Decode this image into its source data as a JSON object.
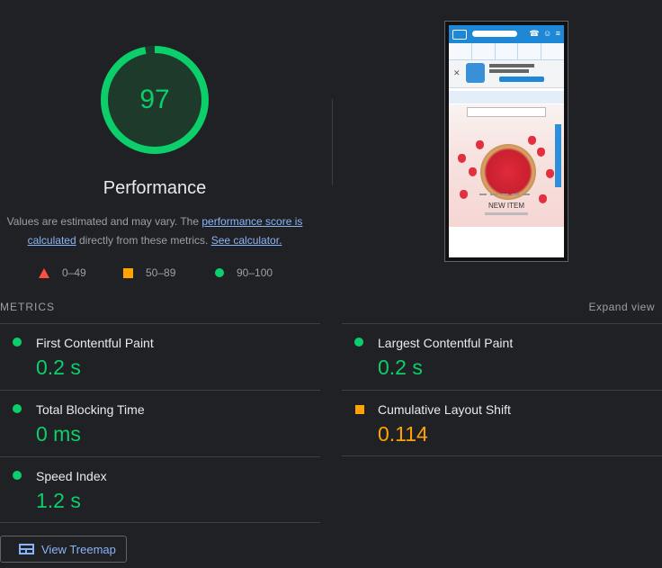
{
  "gauge": {
    "score": "97",
    "title": "Performance",
    "fraction": 0.97,
    "color": "#0cce6b"
  },
  "note": {
    "prefix": "Values are estimated and may vary. The ",
    "link1": "performance score is calculated",
    "middle": " directly from these metrics. ",
    "link2": "See calculator."
  },
  "legend": [
    {
      "icon": "triangle-icon",
      "label": "0–49",
      "color": "#ff4e42"
    },
    {
      "icon": "square-icon",
      "label": "50–89",
      "color": "#ffa400"
    },
    {
      "icon": "circle-icon",
      "label": "90–100",
      "color": "#0cce6b"
    }
  ],
  "screenshot": {
    "new_item": "NEW ITEM"
  },
  "metrics_header": {
    "label": "METRICS",
    "expand": "Expand view"
  },
  "metrics": [
    {
      "name": "First Contentful Paint",
      "value": "0.2 s",
      "status": "pass"
    },
    {
      "name": "Largest Contentful Paint",
      "value": "0.2 s",
      "status": "pass"
    },
    {
      "name": "Total Blocking Time",
      "value": "0 ms",
      "status": "pass"
    },
    {
      "name": "Cumulative Layout Shift",
      "value": "0.114",
      "status": "average"
    },
    {
      "name": "Speed Index",
      "value": "1.2 s",
      "status": "pass"
    }
  ],
  "treemap_button": {
    "label": "View Treemap"
  }
}
